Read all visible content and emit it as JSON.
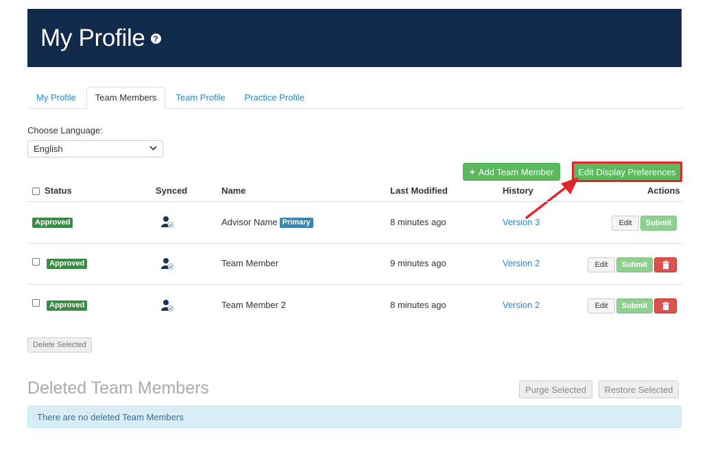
{
  "header": {
    "title": "My Profile",
    "help_icon": "question-circle-icon",
    "help_glyph": "?"
  },
  "tabs": [
    {
      "label": "My Profile",
      "active": false
    },
    {
      "label": "Team Members",
      "active": true
    },
    {
      "label": "Team Profile",
      "active": false
    },
    {
      "label": "Practice Profile",
      "active": false
    }
  ],
  "language": {
    "label": "Choose Language:",
    "selected": "English"
  },
  "toolbar": {
    "add_label": "Add Team Member",
    "add_icon_glyph": "+",
    "prefs_label": "Edit Display Preferences"
  },
  "table": {
    "headers": {
      "status": "Status",
      "synced": "Synced",
      "name": "Name",
      "last_modified": "Last Modified",
      "history": "History",
      "actions": "Actions"
    },
    "rows": [
      {
        "status": "Approved",
        "name": "Advisor Name",
        "badge": "Primary",
        "last_modified": "8 minutes ago",
        "history": "Version 3",
        "edit": "Edit",
        "submit": "Submit"
      },
      {
        "status": "Approved",
        "name": "Team Member",
        "last_modified": "9 minutes ago",
        "history": "Version 2",
        "edit": "Edit",
        "submit": "Submit"
      },
      {
        "status": "Approved",
        "name": "Team Member 2",
        "last_modified": "8 minutes ago",
        "history": "Version 2",
        "edit": "Edit",
        "submit": "Submit"
      }
    ]
  },
  "delete_selected_label": "Delete Selected",
  "deleted_section": {
    "title": "Deleted Team Members",
    "purge_label": "Purge Selected",
    "restore_label": "Restore Selected",
    "empty_message": "There are no deleted Team Members"
  },
  "colors": {
    "header_bg": "#11294a",
    "accent_green": "#5cb85c",
    "highlight_red": "#e0252b",
    "link_blue": "#2a86c4"
  }
}
